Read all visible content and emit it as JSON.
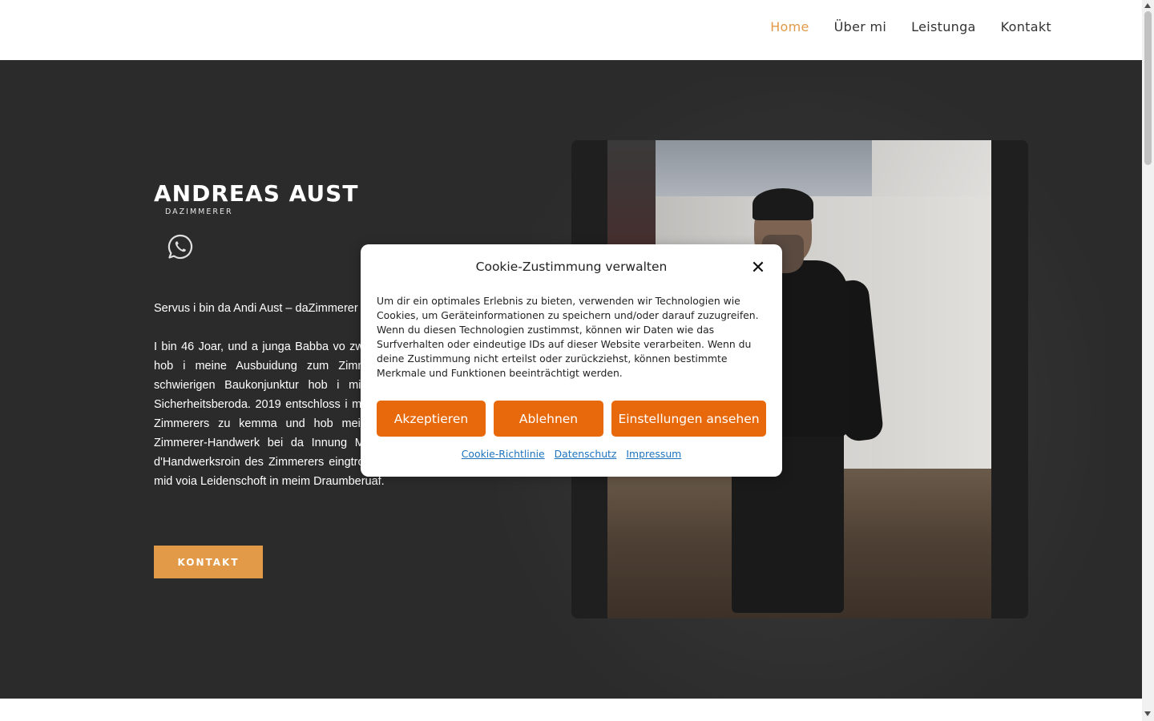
{
  "nav": {
    "items": [
      {
        "label": "Home",
        "active": true
      },
      {
        "label": "Über mi",
        "active": false
      },
      {
        "label": "Leistunga",
        "active": false
      },
      {
        "label": "Kontakt",
        "active": false
      }
    ]
  },
  "hero": {
    "logo_name": "ANDREAS AUST",
    "logo_sub": "DAZIMMERER",
    "whatsapp_icon": "whatsapp-icon",
    "intro": "Servus i bin da Andi Aust – daZimmerer",
    "body": "I bin 46 Joar, und a junga Babba vo zwoa Kinda. Scho in jungen Joarn hob i meine Ausbuidung zum Zimmera obgschlossn. Wegen da schwierigen Baukonjunktur hob i mi umoreantiert und gorbat ois Sicherheitsberoda. 2019 entschloss i mi zruck zur Handwerkskunst des Zimmerers zu kemma und hob meine moasdalichn Fähigkeitn im Zimmerer-Handwerk bei da Innung Minga. Somit konnte i 2022 in d'Handwerksroin des Zimmerers eingtrogn wern und arbade jetz wieda mid voia Leidenschoft in meim Draumberuaf.",
    "button": "KONTAKT"
  },
  "cookie": {
    "title": "Cookie-Zustimmung verwalten",
    "close_icon": "close-icon",
    "text": "Um dir ein optimales Erlebnis zu bieten, verwenden wir Technologien wie Cookies, um Geräteinformationen zu speichern und/oder darauf zuzugreifen. Wenn du diesen Technologien zustimmst, können wir Daten wie das Surfverhalten oder eindeutige IDs auf dieser Website verarbeiten. Wenn du deine Zustimmung nicht erteilst oder zurückziehst, können bestimmte Merkmale und Funktionen beeinträchtigt werden.",
    "accept": "Akzeptieren",
    "deny": "Ablehnen",
    "settings": "Einstellungen ansehen",
    "links": [
      "Cookie-Richtlinie",
      "Datenschutz",
      "Impressum"
    ]
  },
  "colors": {
    "accent": "#e29a48",
    "cookie_button": "#e8690c",
    "hero_bg": "#2b2b2b"
  }
}
